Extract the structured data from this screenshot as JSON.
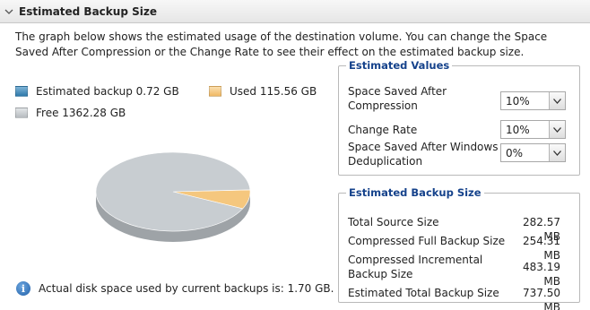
{
  "header": {
    "title": "Estimated Backup Size"
  },
  "description": "The graph below shows the estimated usage of the destination volume. You can change the Space Saved After Compression or the Change Rate to see their effect on the estimated backup size.",
  "legend": {
    "estimated": "Estimated backup 0.72 GB",
    "used": "Used 115.56 GB",
    "free": "Free 1362.28 GB"
  },
  "colors": {
    "estimated": "#3a87b8",
    "used": "#f5c77e",
    "free": "#c8cdd1",
    "group_title": "#15428b"
  },
  "chart_data": {
    "type": "pie",
    "series": [
      {
        "name": "Estimated backup",
        "value": 0.72
      },
      {
        "name": "Used",
        "value": 115.56
      },
      {
        "name": "Free",
        "value": 1362.28
      }
    ]
  },
  "info": {
    "text": "Actual disk space used by current backups is: 1.70 GB."
  },
  "estimated_values": {
    "title": "Estimated Values",
    "space_saved_label": "Space Saved After Compression",
    "space_saved_value": "10%",
    "change_rate_label": "Change Rate",
    "change_rate_value": "10%",
    "dedup_label": "Space Saved After Windows Deduplication",
    "dedup_value": "0%"
  },
  "estimated_backup": {
    "title": "Estimated Backup Size",
    "rows": [
      {
        "label": "Total Source Size",
        "value": "282.57 MB"
      },
      {
        "label": "Compressed Full Backup Size",
        "value": "254.31 MB"
      },
      {
        "label": "Compressed Incremental Backup Size",
        "value": "483.19 MB"
      },
      {
        "label": "Estimated Total Backup Size",
        "value": "737.50 MB"
      }
    ]
  }
}
